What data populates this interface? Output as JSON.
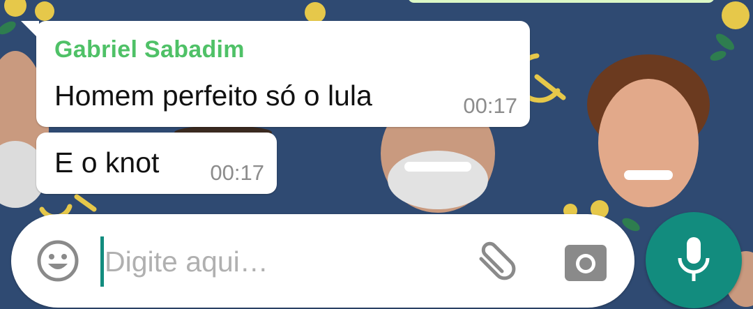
{
  "chat": {
    "messages": [
      {
        "sender": "Gabriel Sabadim",
        "text": "Homem perfeito só o lula",
        "time": "00:17"
      },
      {
        "text": "E o knot",
        "time": "00:17"
      }
    ]
  },
  "composer": {
    "placeholder": "Digite aqui…",
    "value": "",
    "icons": {
      "emoji": "smiley-icon",
      "attach": "paperclip-icon",
      "camera": "camera-icon",
      "mic": "microphone-icon"
    }
  },
  "colors": {
    "wallpaper": "#2f4a72",
    "sender_name": "#4fc167",
    "accent": "#128c7e",
    "outgoing_bubble": "#dcf8c6",
    "incoming_bubble": "#ffffff"
  }
}
